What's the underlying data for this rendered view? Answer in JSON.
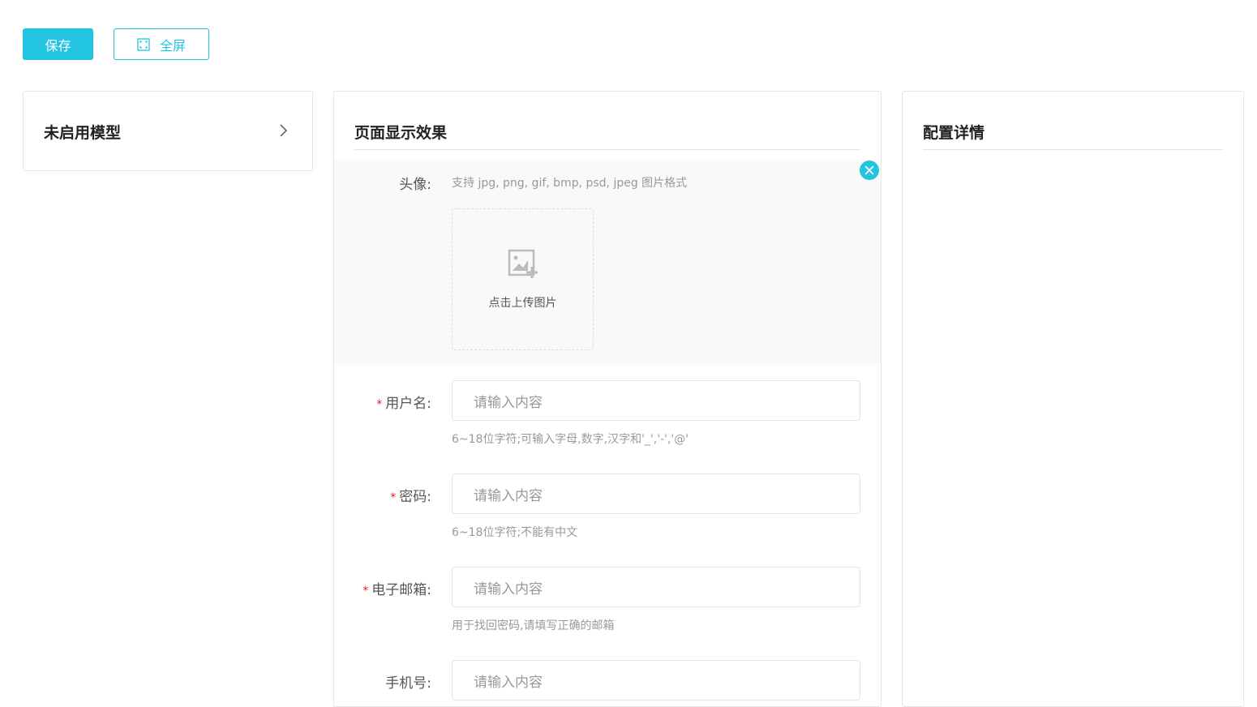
{
  "toolbar": {
    "save": "保存",
    "fullscreen": "全屏"
  },
  "left": {
    "title": "未启用模型"
  },
  "middle": {
    "title": "页面显示效果",
    "avatar": {
      "label": "头像:",
      "hint": "支持 jpg, png, gif, bmp, psd, jpeg 图片格式",
      "upload": "点击上传图片"
    },
    "fields": [
      {
        "label": "用户名:",
        "required": "*",
        "placeholder": "请输入内容",
        "hint": "6~18位字符;可输入字母,数字,汉字和'_','-','@'"
      },
      {
        "label": "密码:",
        "required": "*",
        "placeholder": "请输入内容",
        "hint": "6~18位字符;不能有中文"
      },
      {
        "label": "电子邮箱:",
        "required": "*",
        "placeholder": "请输入内容",
        "hint": "用于找回密码,请填写正确的邮箱"
      },
      {
        "label": "手机号:",
        "placeholder": "请输入内容"
      }
    ]
  },
  "right": {
    "title": "配置详情"
  }
}
